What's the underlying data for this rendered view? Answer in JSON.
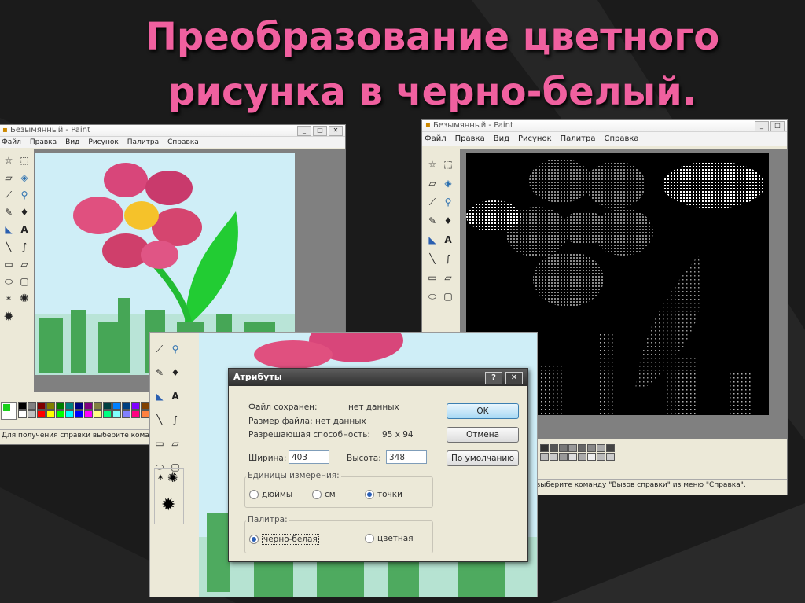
{
  "slide": {
    "title_line1": "Преобразование цветного",
    "title_line2": "рисунка в черно-белый."
  },
  "colors": {
    "title": "#f0609f",
    "background": "#1b1b1b"
  },
  "window_left": {
    "title": "Безымянный - Paint",
    "menu": [
      "Файл",
      "Правка",
      "Вид",
      "Рисунок",
      "Палитра",
      "Справка"
    ],
    "status": "Для получения справки выберите команду \""
  },
  "window_right": {
    "title": "Безымянный - Paint",
    "menu": [
      "Файл",
      "Правка",
      "Вид",
      "Рисунок",
      "Палитра",
      "Справка"
    ],
    "status": "выберите команду \"Вызов справки\" из меню \"Справка\"."
  },
  "tool_icons": [
    "star-select-icon",
    "rect-select-icon",
    "eraser-icon",
    "fill-icon",
    "eyedropper-icon",
    "magnifier-icon",
    "pencil-icon",
    "brush-icon",
    "airbrush-icon",
    "text-icon",
    "line-icon",
    "curve-icon",
    "rectangle-icon",
    "polygon-icon",
    "ellipse-icon",
    "rounded-rect-icon"
  ],
  "dialog": {
    "title": "Атрибуты",
    "help_btn": "?",
    "close_btn": "✕",
    "file_saved_label": "Файл сохранен:",
    "file_saved_value": "нет данных",
    "file_size_label": "Размер файла: нет данных",
    "resolution_label": "Разрешающая способность:",
    "resolution_value": "95 x 94",
    "width_label": "Ширина:",
    "width_value": "403",
    "height_label": "Высота:",
    "height_value": "348",
    "units_group": "Единицы измерения:",
    "units": [
      "дюймы",
      "см",
      "точки"
    ],
    "units_selected": "точки",
    "palette_group": "Палитра:",
    "palette_options": [
      "черно-белая",
      "цветная"
    ],
    "palette_selected": "черно-белая",
    "ok_btn": "OK",
    "cancel_btn": "Отмена",
    "default_btn": "По умолчанию"
  }
}
